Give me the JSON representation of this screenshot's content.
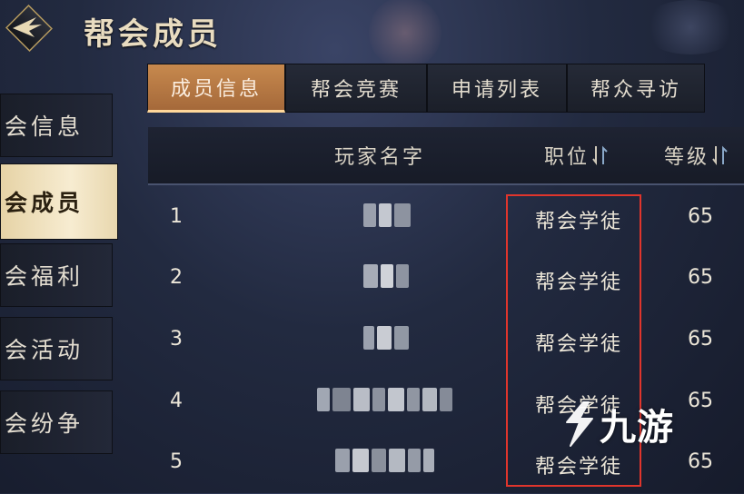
{
  "header": {
    "title": "帮会成员"
  },
  "sidebar": {
    "items": [
      {
        "label": "会信息"
      },
      {
        "label": "会成员"
      },
      {
        "label": "会福利"
      },
      {
        "label": "会活动"
      },
      {
        "label": "会纷争"
      }
    ]
  },
  "tabs": [
    {
      "label": "成员信息"
    },
    {
      "label": "帮会竞赛"
    },
    {
      "label": "申请列表"
    },
    {
      "label": "帮众寻访"
    }
  ],
  "table": {
    "columns": {
      "name": "玩家名字",
      "position": "职位",
      "level": "等级"
    },
    "rows": [
      {
        "index": "1",
        "position": "帮会学徒",
        "level": "65"
      },
      {
        "index": "2",
        "position": "帮会学徒",
        "level": "65"
      },
      {
        "index": "3",
        "position": "帮会学徒",
        "level": "65"
      },
      {
        "index": "4",
        "position": "帮会学徒",
        "level": "65"
      },
      {
        "index": "5",
        "position": "帮会学徒",
        "level": "65"
      }
    ]
  },
  "watermark": {
    "text": "九游"
  },
  "colors": {
    "accent_tab": "#b77a45",
    "highlight_box": "#e0352c",
    "active_side": "#f2e4c2"
  }
}
